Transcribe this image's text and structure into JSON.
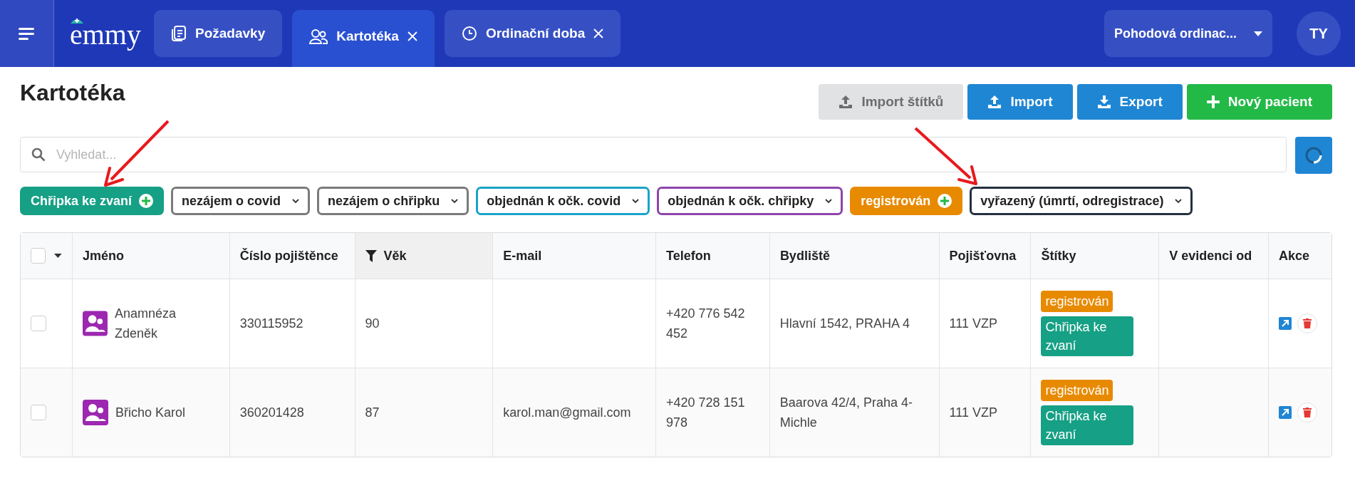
{
  "header": {
    "logo": "emmy",
    "tabs": [
      {
        "label": "Požadavky",
        "kind": "document",
        "selected": false,
        "closable": false
      },
      {
        "label": "Kartotéka",
        "kind": "people",
        "selected": true,
        "closable": true
      },
      {
        "label": "Ordinační doba",
        "kind": "clock",
        "selected": false,
        "closable": true
      }
    ],
    "practice": "Pohodová ordinac...",
    "avatar": "TY"
  },
  "title": "Kartotéka",
  "actions": [
    {
      "label": "Import štítků",
      "kind": "upload",
      "disabled": true,
      "color": "#e1e2e4"
    },
    {
      "label": "Import",
      "kind": "upload",
      "disabled": false,
      "color": "#1f86d4"
    },
    {
      "label": "Export",
      "kind": "download",
      "disabled": false,
      "color": "#1f86d4"
    },
    {
      "label": "Nový pacient",
      "kind": "add",
      "disabled": false,
      "color": "#22b947"
    }
  ],
  "search": {
    "placeholder": "Vyhledat..."
  },
  "filters": [
    {
      "label": "Chřipka ke zvaní",
      "kind": "active",
      "color": "#16a085"
    },
    {
      "label": "nezájem o covid",
      "kind": "dropdown",
      "color": "#7a7a7a"
    },
    {
      "label": "nezájem o chřipku",
      "kind": "dropdown",
      "color": "#7a7a7a"
    },
    {
      "label": "objednán k očk. covid",
      "kind": "dropdown",
      "color": "#1aa3c8"
    },
    {
      "label": "objednán k očk. chřipky",
      "kind": "dropdown",
      "color": "#8e44ad"
    },
    {
      "label": "registrován",
      "kind": "active",
      "color": "#e88a00"
    },
    {
      "label": "vyřazený (úmrtí, odregistrace)",
      "kind": "dropdown",
      "color": "#243040"
    }
  ],
  "table": {
    "columns": [
      {
        "label": "Jméno",
        "filtered": false
      },
      {
        "label": "Číslo pojištěnce",
        "filtered": false
      },
      {
        "label": "Věk",
        "filtered": true
      },
      {
        "label": "E-mail",
        "filtered": false
      },
      {
        "label": "Telefon",
        "filtered": false
      },
      {
        "label": "Bydliště",
        "filtered": false
      },
      {
        "label": "Pojišťovna",
        "filtered": false
      },
      {
        "label": "Štítky",
        "filtered": false
      },
      {
        "label": "V evidenci od",
        "filtered": false
      },
      {
        "label": "Akce",
        "filtered": false
      }
    ],
    "select_all": {
      "checked": false
    },
    "rows": [
      {
        "checked": false,
        "name": "Anamnéza Zdeněk",
        "insurance_no": "330115952",
        "age": "90",
        "email": "",
        "phone": "+420 776 542 452",
        "address": "Hlavní 1542, PRAHA 4",
        "insurer": "111 VZP",
        "tags": [
          {
            "label": "registrován",
            "color": "#e88a00"
          },
          {
            "label": "Chřipka ke zvaní",
            "color": "#16a085"
          }
        ]
      },
      {
        "checked": false,
        "name": "Břicho Karol",
        "insurance_no": "360201428",
        "age": "87",
        "email": "karol.man@gmail.com",
        "phone": "+420 728 151 978",
        "address": "Baarova 42/4, Praha 4-Michle",
        "insurer": "111 VZP",
        "tags": [
          {
            "label": "registrován",
            "color": "#e88a00"
          },
          {
            "label": "Chřipka ke zvaní",
            "color": "#16a085"
          }
        ]
      }
    ]
  }
}
